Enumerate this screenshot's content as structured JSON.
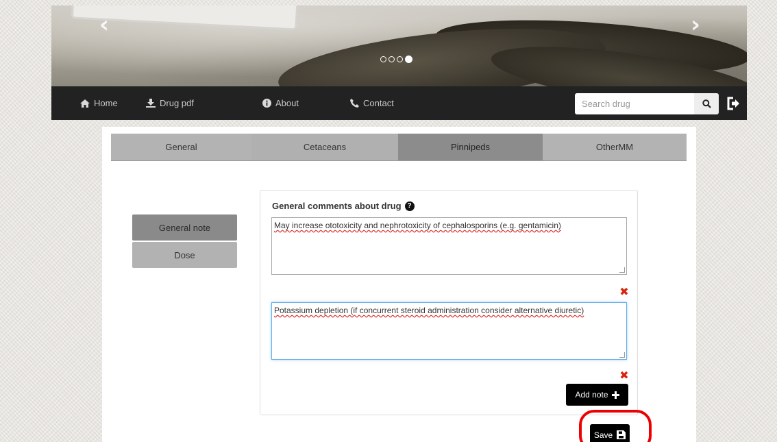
{
  "banner": {
    "prev_icon": "chevron-left-icon",
    "next_icon": "chevron-right-icon",
    "slides_count": 4,
    "active_slide": 4
  },
  "nav": {
    "home": "Home",
    "drug_pdf": "Drug pdf",
    "about": "About",
    "contact": "Contact",
    "search_placeholder": "Search drug",
    "search_icon": "search-icon",
    "logout_icon": "sign-out-icon"
  },
  "tabs": [
    {
      "label": "General"
    },
    {
      "label": "Cetaceans"
    },
    {
      "label": "Pinnipeds",
      "active": true
    },
    {
      "label": "OtherMM"
    }
  ],
  "side_menu": {
    "general_note": "General note",
    "dose": "Dose"
  },
  "card": {
    "title": "General comments about drug",
    "help_icon": "question-circle-icon",
    "notes": [
      "May increase ototoxicity and nephrotoxicity of cephalosporins (e.g. gentamicin)",
      "Potassium depletion (if concurrent steroid administration consider alternative diuretic)"
    ],
    "remove_icon": "remove-x-icon",
    "add_note_label": "Add note",
    "add_icon": "plus-icon"
  },
  "save": {
    "label": "Save",
    "icon": "save-icon"
  },
  "colors": {
    "navbar": "#222222",
    "active_tab": "#8c8c8c",
    "inactive_tab": "#b3b3b3",
    "highlight": "#ee0000",
    "remove": "#d9230f"
  }
}
